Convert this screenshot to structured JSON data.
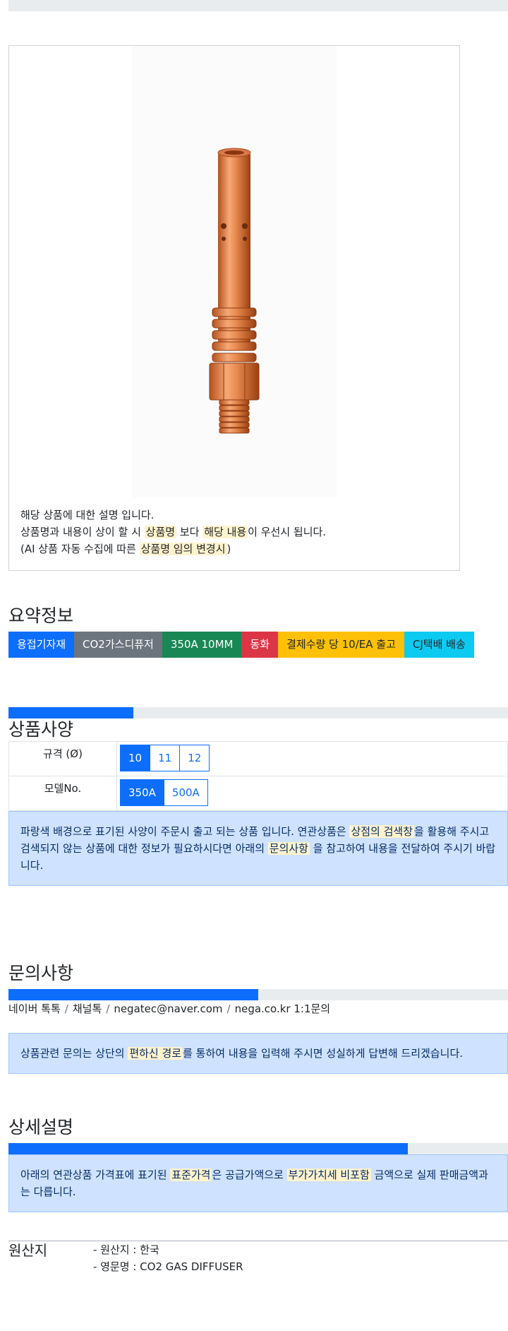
{
  "product": {
    "desc_line1": "해당 상품에 대한 설명 입니다.",
    "desc_line2_a": "상품명과 내용이 상이 할 시 ",
    "desc_line2_hl1": "상품명",
    "desc_line2_b": " 보다 ",
    "desc_line2_hl2": "해당 내용",
    "desc_line2_c": "이 우선시 됩니다.",
    "desc_line3_a": "(AI 상품 자동 수집에 따른 ",
    "desc_line3_hl": "상품명 임의 변경시",
    "desc_line3_b": ")",
    "image_icon": "copper-contact-tip-diffuser-photo"
  },
  "summary": {
    "title": "요약정보",
    "tags": [
      "용접기자재",
      "CO2가스디퓨저",
      "350A 10MM",
      "동화",
      "결제수량 당 10/EA 출고",
      "CJ택배 배송"
    ]
  },
  "spec": {
    "title": "상품사양",
    "progress": 0.25,
    "rows": [
      {
        "label": "규격 (Ø)",
        "options": [
          "10",
          "11",
          "12"
        ],
        "selected": "10"
      },
      {
        "label": "모델No.",
        "options": [
          "350A",
          "500A"
        ],
        "selected": "350A"
      }
    ],
    "notice_a": "파랑색 배경으로 표기된 사양이 주문시 출고 되는 상품 입니다. 연관상품은 ",
    "notice_hl1": "상점의 검색창",
    "notice_b": "을 활용해 주시고 검색되지 않는 상품에 대한 정보가 필요하시다면 아래의 ",
    "notice_hl2": "문의사항",
    "notice_c": " 을 참고하여 내용을 전달하여 주시기 바랍니다."
  },
  "inquiry": {
    "title": "문의사항",
    "progress": 0.5,
    "links": [
      "네이버 톡톡",
      "채널톡",
      "negatec@naver.com",
      "nega.co.kr 1:1문의"
    ],
    "separator": "/",
    "notice_a": "상품관련 문의는 상단의 ",
    "notice_hl": "편하신 경로",
    "notice_b": "를 통하여 내용을 입력해 주시면 성실하게 답변해 드리겠습니다."
  },
  "detail": {
    "title": "상세설명",
    "progress": 0.8,
    "notice_a": "아래의 연관상품 가격표에 표기된 ",
    "notice_hl1": "표준가격",
    "notice_b": "은 공급가액으로 ",
    "notice_hl2": "부가가치세 비포함",
    "notice_c": " 금액으로 실제 판매금액과는 다릅니다."
  },
  "origin": {
    "label": "원산지",
    "lines": [
      "- 원산지 : 한국",
      "- 영문명 : CO2 GAS DIFFUSER"
    ]
  }
}
